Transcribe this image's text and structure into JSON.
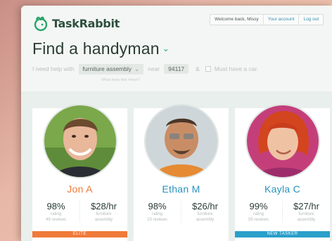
{
  "brand": {
    "name_part1": "Task",
    "name_part2": "Rabbit",
    "accent": "#2aa36b"
  },
  "account": {
    "welcome": "Welcome back, Missy",
    "your_account": "Your account",
    "log_out": "Log out"
  },
  "headline": {
    "title": "Find a handyman",
    "chevron": "⌄"
  },
  "search": {
    "prefix": "I need help with",
    "task_value": "furniture assembly",
    "near_label": "near",
    "zip_value": "94117",
    "amp": "&",
    "car_label": "Must have a car.",
    "hint": "What does this mean?"
  },
  "taskers": [
    {
      "name": "Jon A",
      "name_color": "#f07a3a",
      "rating": "98%",
      "rating_label": "rating",
      "reviews": "49 reviews",
      "rate": "$28/hr",
      "rate_label_1": "furniture",
      "rate_label_2": "assembly",
      "badge": "ELITE",
      "badge_color": "#f07a3a"
    },
    {
      "name": "Ethan M",
      "name_color": "#2a93bd",
      "rating": "98%",
      "rating_label": "rating",
      "reviews": "23 reviews",
      "rate": "$26/hr",
      "rate_label_1": "furniture",
      "rate_label_2": "assembly",
      "badge": "",
      "badge_color": ""
    },
    {
      "name": "Kayla C",
      "name_color": "#2a93bd",
      "rating": "99%",
      "rating_label": "rating",
      "reviews": "55 reviews",
      "rate": "$27/hr",
      "rate_label_1": "furniture",
      "rate_label_2": "assembly",
      "badge": "NEW TASKER",
      "badge_color": "#2a9fc9"
    }
  ]
}
